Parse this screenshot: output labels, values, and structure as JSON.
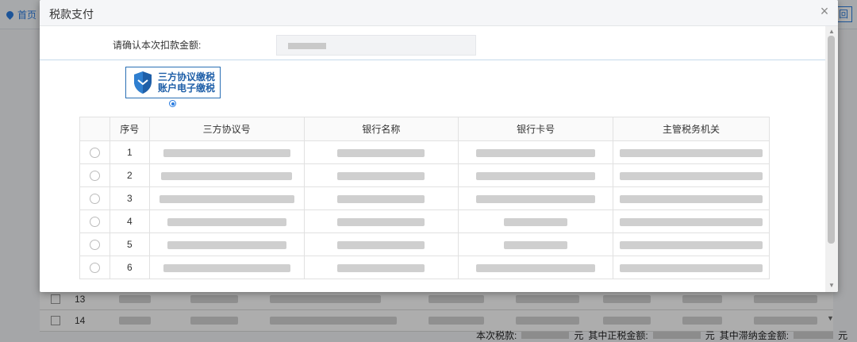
{
  "background": {
    "home_label": "首页",
    "return_label": "回",
    "rows": [
      {
        "index": "13"
      },
      {
        "index": "14"
      }
    ],
    "footer": {
      "this_tax_label": "本次税款:",
      "yuan1": "元",
      "main_tax_label": "其中正税金额:",
      "yuan2": "元",
      "late_fee_label": "其中滞纳金金额:",
      "yuan3": "元"
    }
  },
  "dialog": {
    "title": "税款支付",
    "close_icon": "close-icon",
    "amount_label": "请确认本次扣款金额:",
    "method": {
      "line1": "三方协议缴税",
      "line2": "账户电子缴税",
      "selected": true
    },
    "table": {
      "headers": [
        "",
        "序号",
        "三方协议号",
        "银行名称",
        "银行卡号",
        "主管税务机关"
      ],
      "rows": [
        {
          "seq": "1"
        },
        {
          "seq": "2"
        },
        {
          "seq": "3"
        },
        {
          "seq": "4"
        },
        {
          "seq": "5"
        },
        {
          "seq": "6"
        }
      ]
    }
  },
  "colors": {
    "accent": "#2a7ce0",
    "method_border": "#2a6fb4",
    "shield": "#1f5fa8"
  }
}
